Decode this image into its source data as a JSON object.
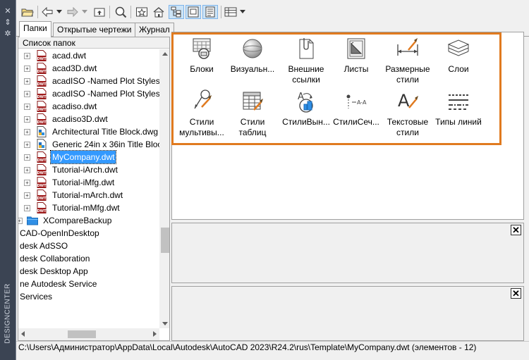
{
  "palette": {
    "title": "DESIGNCENTER",
    "accent": "#e07a1f",
    "selection": "#3399ff"
  },
  "tabs": [
    {
      "label": "Папки",
      "active": true
    },
    {
      "label": "Открытые чертежи",
      "active": false
    },
    {
      "label": "Журнал",
      "active": false
    }
  ],
  "tree": {
    "header": "Список папок",
    "rows": [
      {
        "label": "acad.dwt",
        "icon": "dwt-file-icon"
      },
      {
        "label": "acad3D.dwt",
        "icon": "dwt-file-icon"
      },
      {
        "label": "acadISO -Named Plot Styles.",
        "icon": "dwt-file-icon"
      },
      {
        "label": "acadISO -Named Plot Styles3",
        "icon": "dwt-file-icon"
      },
      {
        "label": "acadiso.dwt",
        "icon": "dwt-file-icon"
      },
      {
        "label": "acadiso3D.dwt",
        "icon": "dwt-file-icon"
      },
      {
        "label": "Architectural Title Block.dwg",
        "icon": "dwg-file-icon"
      },
      {
        "label": "Generic 24in x 36in Title Bloc",
        "icon": "dwg-file-icon"
      },
      {
        "label": "MyCompany.dwt",
        "icon": "dwt-file-icon",
        "selected": true
      },
      {
        "label": "Tutorial-iArch.dwt",
        "icon": "dwt-file-icon"
      },
      {
        "label": "Tutorial-iMfg.dwt",
        "icon": "dwt-file-icon"
      },
      {
        "label": "Tutorial-mArch.dwt",
        "icon": "dwt-file-icon"
      },
      {
        "label": "Tutorial-mMfg.dwt",
        "icon": "dwt-file-icon"
      },
      {
        "label": "XCompareBackup",
        "icon": "folder-icon"
      },
      {
        "label": "CAD-OpenInDesktop"
      },
      {
        "label": "desk AdSSO"
      },
      {
        "label": "desk Collaboration"
      },
      {
        "label": "desk Desktop App"
      },
      {
        "label": "ne Autodesk Service"
      },
      {
        "label": "Services"
      }
    ]
  },
  "items": [
    {
      "label": "Блоки",
      "icon": "blocks-icon"
    },
    {
      "label": "Визуальн...",
      "icon": "visual-styles-icon"
    },
    {
      "label": "Внешние ссылки",
      "icon": "xref-icon"
    },
    {
      "label": "Листы",
      "icon": "layouts-icon"
    },
    {
      "label": "Размерные стили",
      "icon": "dimension-styles-icon"
    },
    {
      "label": "Слои",
      "icon": "layers-icon"
    },
    {
      "label": "Стили мультивы...",
      "icon": "mleader-styles-icon"
    },
    {
      "label": "Стили таблиц",
      "icon": "table-styles-icon"
    },
    {
      "label": "СтилиВын...",
      "icon": "callout-styles-icon"
    },
    {
      "label": "СтилиСеч...",
      "icon": "section-styles-icon"
    },
    {
      "label": "Текстовые стили",
      "icon": "text-styles-icon"
    },
    {
      "label": "Типы линий",
      "icon": "linetypes-icon"
    }
  ],
  "close_glyph": "✕",
  "status": "C:\\Users\\Администратор\\AppData\\Local\\Autodesk\\AutoCAD 2023\\R24.2\\rus\\Template\\MyCompany.dwt (элементов  - 12)"
}
